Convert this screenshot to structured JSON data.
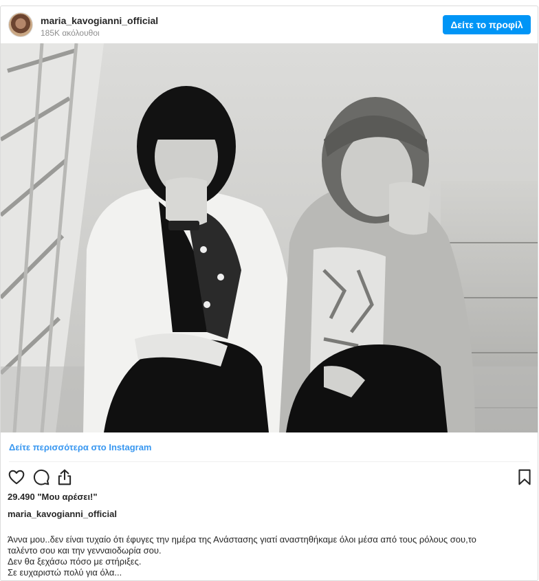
{
  "header": {
    "username": "maria_kavogianni_official",
    "followers": "185K ακόλουθοι",
    "profile_button": "Δείτε το προφίλ"
  },
  "photo": {
    "description_icon": "black-and-white-photo"
  },
  "more_link": "Δείτε περισσότερα στο Instagram",
  "actions": {
    "like_icon": "heart-icon",
    "comment_icon": "comment-icon",
    "share_icon": "share-icon",
    "save_icon": "bookmark-icon"
  },
  "likes": "29.490 \"Μου αρέσει!\"",
  "caption": {
    "username": "maria_kavogianni_official",
    "lines": [
      "Άννα μου..δεν είναι τυχαίο ότι έφυγες την ημέρα της Ανάστασης γιατί αναστηθήκαμε όλοι μέσα από τους ρόλους σου,το",
      "ταλέντο σου και την γενναιοδωρία σου.",
      "Δεν θα ξεχάσω πόσο με στήριξες.",
      "Σε ευχαριστώ πολύ για όλα..."
    ]
  },
  "colors": {
    "accent": "#0095f6",
    "link": "#3897f0",
    "text": "#262626",
    "muted": "#8e8e8e",
    "border": "#dbdbdb"
  }
}
